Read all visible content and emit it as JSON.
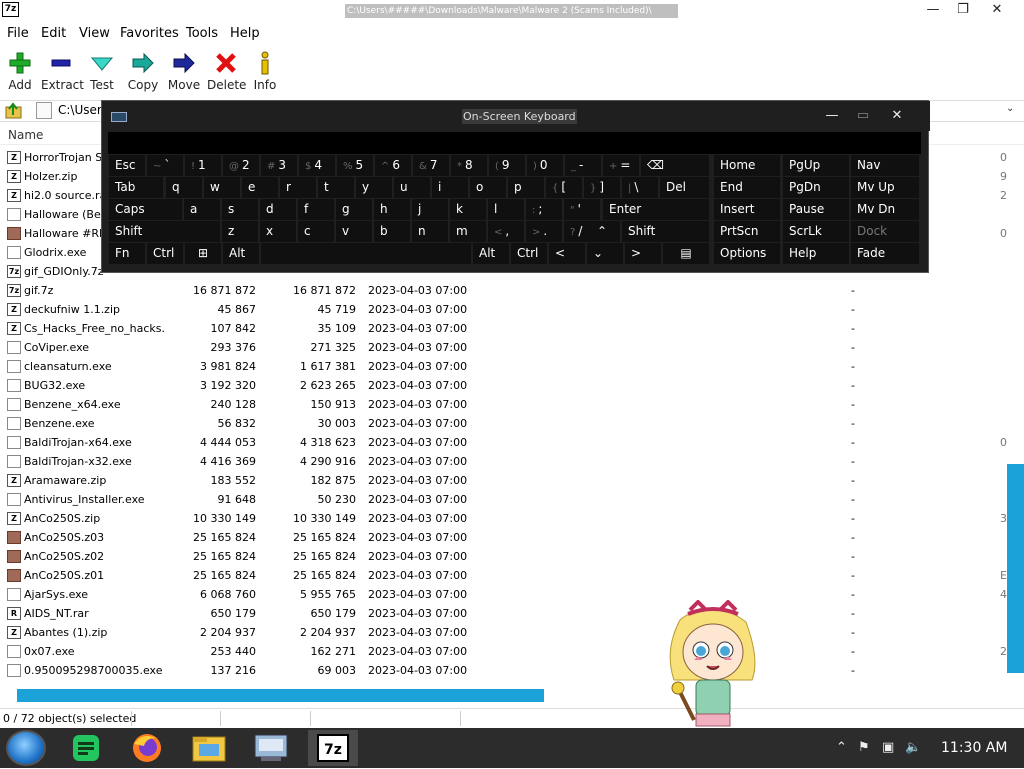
{
  "window": {
    "icon_text": "7z",
    "title": "C:\\Users\\#####\\Downloads\\Malware\\Malware 2 (Scams Included)\\",
    "minimize": "—",
    "maximize": "❐",
    "close": "✕"
  },
  "menu": [
    "File",
    "Edit",
    "View",
    "Favorites",
    "Tools",
    "Help"
  ],
  "toolbar": [
    {
      "label": "Add",
      "icon": "add-icon"
    },
    {
      "label": "Extract",
      "icon": "extract-icon"
    },
    {
      "label": "Test",
      "icon": "test-icon"
    },
    {
      "label": "Copy",
      "icon": "copy-icon"
    },
    {
      "label": "Move",
      "icon": "move-icon"
    },
    {
      "label": "Delete",
      "icon": "delete-icon"
    },
    {
      "label": "Info",
      "icon": "info-icon"
    }
  ],
  "path": "C:\\Users",
  "columns": {
    "name": "Name"
  },
  "files": [
    {
      "icon": "archive",
      "name": "HorrorTrojan Sp",
      "size": "",
      "packed": "",
      "modified": "",
      "dash": "",
      "edge": "0"
    },
    {
      "icon": "archive",
      "name": "Holzer.zip",
      "size": "",
      "packed": "",
      "modified": "",
      "dash": "",
      "edge": "9"
    },
    {
      "icon": "archive",
      "name": "hi2.0 source.rar",
      "size": "",
      "packed": "",
      "modified": "",
      "dash": "",
      "edge": "2"
    },
    {
      "icon": "exe",
      "name": "Halloware (Berk",
      "size": "",
      "packed": "",
      "modified": "",
      "dash": "",
      "edge": ""
    },
    {
      "icon": "doc",
      "name": "Halloware #REA",
      "size": "",
      "packed": "",
      "modified": "",
      "dash": "",
      "edge": "0"
    },
    {
      "icon": "exe",
      "name": "Glodrix.exe",
      "size": "",
      "packed": "",
      "modified": "",
      "dash": "",
      "edge": ""
    },
    {
      "icon": "7z",
      "name": "gif_GDIOnly.7z",
      "size": "",
      "packed": "",
      "modified": "",
      "dash": "",
      "edge": ""
    },
    {
      "icon": "7z",
      "name": "gif.7z",
      "size": "16 871 872",
      "packed": "16 871 872",
      "modified": "2023-04-03 07:00",
      "dash": "-",
      "edge": ""
    },
    {
      "icon": "archive",
      "name": "deckufniw 1.1.zip",
      "size": "45 867",
      "packed": "45 719",
      "modified": "2023-04-03 07:00",
      "dash": "-",
      "edge": ""
    },
    {
      "icon": "archive",
      "name": "Cs_Hacks_Free_no_hacks....",
      "size": "107 842",
      "packed": "35 109",
      "modified": "2023-04-03 07:00",
      "dash": "-",
      "edge": ""
    },
    {
      "icon": "exe",
      "name": "CoViper.exe",
      "size": "293 376",
      "packed": "271 325",
      "modified": "2023-04-03 07:00",
      "dash": "-",
      "edge": ""
    },
    {
      "icon": "exe",
      "name": "cleansaturn.exe",
      "size": "3 981 824",
      "packed": "1 617 381",
      "modified": "2023-04-03 07:00",
      "dash": "-",
      "edge": ""
    },
    {
      "icon": "exe",
      "name": "BUG32.exe",
      "size": "3 192 320",
      "packed": "2 623 265",
      "modified": "2023-04-03 07:00",
      "dash": "-",
      "edge": ""
    },
    {
      "icon": "exe",
      "name": "Benzene_x64.exe",
      "size": "240 128",
      "packed": "150 913",
      "modified": "2023-04-03 07:00",
      "dash": "-",
      "edge": ""
    },
    {
      "icon": "exe",
      "name": "Benzene.exe",
      "size": "56 832",
      "packed": "30 003",
      "modified": "2023-04-03 07:00",
      "dash": "-",
      "edge": ""
    },
    {
      "icon": "exe",
      "name": "BaldiTrojan-x64.exe",
      "size": "4 444 053",
      "packed": "4 318 623",
      "modified": "2023-04-03 07:00",
      "dash": "-",
      "edge": "0"
    },
    {
      "icon": "exe",
      "name": "BaldiTrojan-x32.exe",
      "size": "4 416 369",
      "packed": "4 290 916",
      "modified": "2023-04-03 07:00",
      "dash": "-",
      "edge": ""
    },
    {
      "icon": "archive",
      "name": "Aramaware.zip",
      "size": "183 552",
      "packed": "182 875",
      "modified": "2023-04-03 07:00",
      "dash": "-",
      "edge": ""
    },
    {
      "icon": "exe",
      "name": "Antivirus_Installer.exe",
      "size": "91 648",
      "packed": "50 230",
      "modified": "2023-04-03 07:00",
      "dash": "-",
      "edge": ""
    },
    {
      "icon": "archive",
      "name": "AnCo250S.zip",
      "size": "10 330 149",
      "packed": "10 330 149",
      "modified": "2023-04-03 07:00",
      "dash": "-",
      "edge": "3"
    },
    {
      "icon": "doc",
      "name": "AnCo250S.z03",
      "size": "25 165 824",
      "packed": "25 165 824",
      "modified": "2023-04-03 07:00",
      "dash": "-",
      "edge": ""
    },
    {
      "icon": "doc",
      "name": "AnCo250S.z02",
      "size": "25 165 824",
      "packed": "25 165 824",
      "modified": "2023-04-03 07:00",
      "dash": "-",
      "edge": ""
    },
    {
      "icon": "doc",
      "name": "AnCo250S.z01",
      "size": "25 165 824",
      "packed": "25 165 824",
      "modified": "2023-04-03 07:00",
      "dash": "-",
      "edge": "E"
    },
    {
      "icon": "exe",
      "name": "AjarSys.exe",
      "size": "6 068 760",
      "packed": "5 955 765",
      "modified": "2023-04-03 07:00",
      "dash": "-",
      "edge": "4"
    },
    {
      "icon": "rar",
      "name": "AIDS_NT.rar",
      "size": "650 179",
      "packed": "650 179",
      "modified": "2023-04-03 07:00",
      "dash": "-",
      "edge": ""
    },
    {
      "icon": "archive",
      "name": "Abantes (1).zip",
      "size": "2 204 937",
      "packed": "2 204 937",
      "modified": "2023-04-03 07:00",
      "dash": "-",
      "edge": ""
    },
    {
      "icon": "exe",
      "name": "0x07.exe",
      "size": "253 440",
      "packed": "162 271",
      "modified": "2023-04-03 07:00",
      "dash": "-",
      "edge": "2"
    },
    {
      "icon": "exe",
      "name": "0.950095298700035.exe",
      "size": "137 216",
      "packed": "69 003",
      "modified": "2023-04-03 07:00",
      "dash": "-",
      "edge": ""
    }
  ],
  "status": "0 / 72 object(s) selected",
  "osk": {
    "title": "On-Screen Keyboard",
    "minimize": "—",
    "restore": "▭",
    "close": "✕",
    "keys": [
      {
        "sub": "~",
        "main": "`"
      },
      {
        "sub": "!",
        "main": "1"
      },
      {
        "sub": "@",
        "main": "2"
      },
      {
        "sub": "#",
        "main": "3"
      },
      {
        "sub": "$",
        "main": "4"
      },
      {
        "sub": "%",
        "main": "5"
      },
      {
        "sub": "^",
        "main": "6"
      },
      {
        "sub": "&",
        "main": "7"
      },
      {
        "sub": "*",
        "main": "8"
      },
      {
        "sub": "(",
        "main": "9"
      },
      {
        "sub": ")",
        "main": "0"
      },
      {
        "sub": "_",
        "main": "-"
      },
      {
        "sub": "+",
        "main": "="
      }
    ],
    "labels": {
      "esc": "Esc",
      "backspace": "⌫",
      "tab": "Tab",
      "del": "Del",
      "caps": "Caps",
      "enter": "Enter",
      "shift": "Shift",
      "fn": "Fn",
      "ctrl": "Ctrl",
      "alt": "Alt",
      "win": "⊞",
      "menu": "▤",
      "left": "<",
      "down": "⌄",
      "right": ">",
      "up": "⌃",
      "home": "Home",
      "pgup": "PgUp",
      "nav": "Nav",
      "end": "End",
      "pgdn": "PgDn",
      "mvup": "Mv Up",
      "insert": "Insert",
      "pause": "Pause",
      "mvdn": "Mv Dn",
      "prtscn": "PrtScn",
      "scrlk": "ScrLk",
      "dock": "Dock",
      "options": "Options",
      "help": "Help",
      "fade": "Fade"
    },
    "row2": [
      "q",
      "w",
      "e",
      "r",
      "t",
      "y",
      "u",
      "i",
      "o",
      "p"
    ],
    "row2b": [
      {
        "sub": "{",
        "main": "["
      },
      {
        "sub": "}",
        "main": "]"
      },
      {
        "sub": "|",
        "main": "\\"
      }
    ],
    "row3": [
      "a",
      "s",
      "d",
      "f",
      "g",
      "h",
      "j",
      "k",
      "l"
    ],
    "row3b": [
      {
        "sub": ":",
        "main": ";"
      },
      {
        "sub": "\"",
        "main": "'"
      }
    ],
    "row4": [
      "z",
      "x",
      "c",
      "v",
      "b",
      "n",
      "m"
    ],
    "row4b": [
      {
        "sub": "<",
        "main": ","
      },
      {
        "sub": ">",
        "main": "."
      },
      {
        "sub": "?",
        "main": "/"
      }
    ]
  },
  "taskbar": {
    "clock": "11:30 AM",
    "apps": [
      "start-orb",
      "notes-app",
      "firefox",
      "file-explorer",
      "on-screen-keyboard",
      "7-zip"
    ]
  }
}
